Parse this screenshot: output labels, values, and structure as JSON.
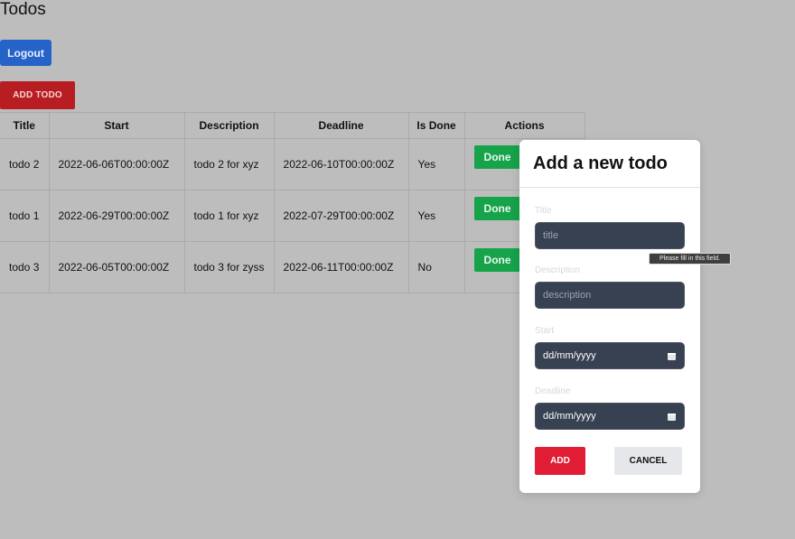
{
  "page": {
    "title": "Todos"
  },
  "buttons": {
    "logout": "Logout",
    "add_todo": "ADD TODO"
  },
  "table": {
    "headers": [
      "Title",
      "Start",
      "Description",
      "Deadline",
      "Is Done",
      "Actions"
    ],
    "rows": [
      {
        "title": "todo 2",
        "start": "2022-06-06T00:00:00Z",
        "description": "todo 2 for xyz",
        "deadline": "2022-06-10T00:00:00Z",
        "is_done": "Yes",
        "action": "Done"
      },
      {
        "title": "todo 1",
        "start": "2022-06-29T00:00:00Z",
        "description": "todo 1 for xyz",
        "deadline": "2022-07-29T00:00:00Z",
        "is_done": "Yes",
        "action": "Done"
      },
      {
        "title": "todo 3",
        "start": "2022-06-05T00:00:00Z",
        "description": "todo 3 for zyss",
        "deadline": "2022-06-11T00:00:00Z",
        "is_done": "No",
        "action": "Done"
      }
    ]
  },
  "modal": {
    "title": "Add a new todo",
    "fields": {
      "title": {
        "label": "Title",
        "placeholder": "title"
      },
      "description": {
        "label": "Description",
        "placeholder": "description"
      },
      "start": {
        "label": "Start",
        "value": "dd/mm/yyyy",
        "icon": "calendar-icon"
      },
      "deadline": {
        "label": "Deadline",
        "value": "dd/mm/yyyy",
        "icon": "calendar-icon"
      }
    },
    "add_label": "ADD",
    "cancel_label": "CANCEL"
  },
  "tooltip": {
    "text": "Please fill in this field."
  },
  "colors": {
    "logout": "#2563c9",
    "add_todo": "#b81d22",
    "done": "#16a34a",
    "modal_add": "#e11d35",
    "input_bg": "#374151"
  }
}
